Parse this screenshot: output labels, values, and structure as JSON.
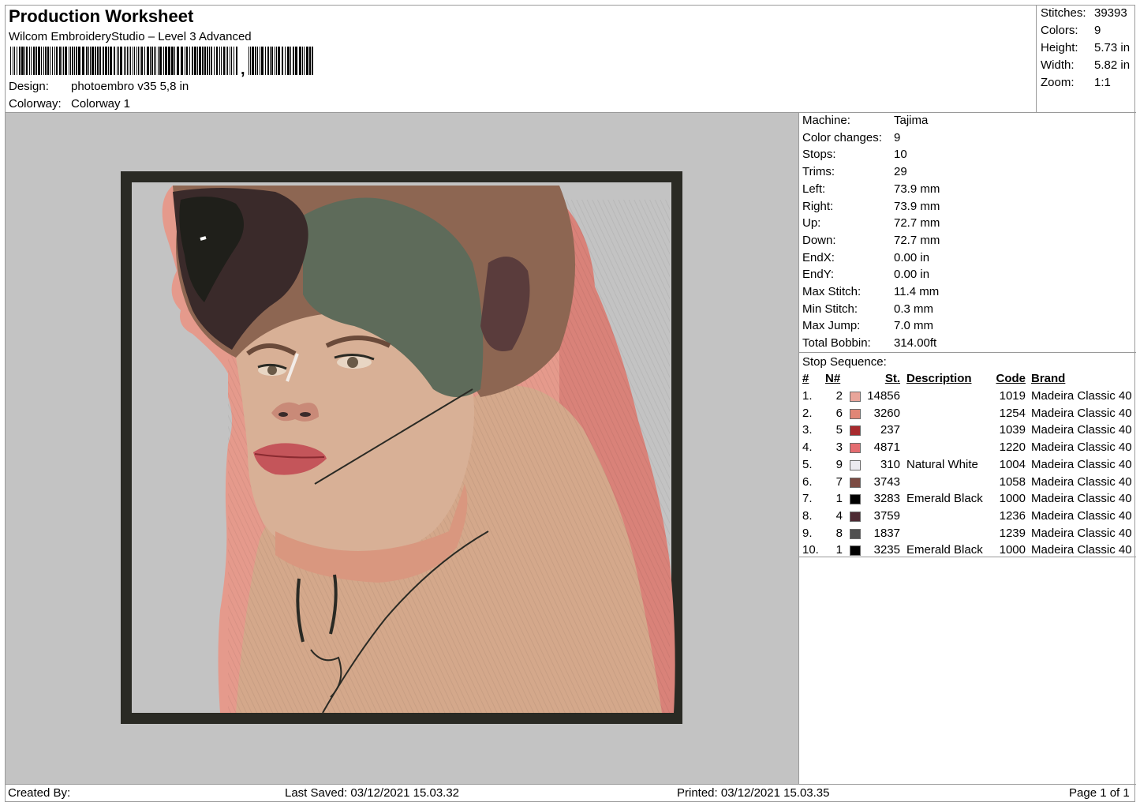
{
  "header": {
    "title": "Production Worksheet",
    "subtitle": "Wilcom EmbroideryStudio – Level 3 Advanced",
    "design_label": "Design:",
    "design_value": "photoembro v35 5,8 in",
    "colorway_label": "Colorway:",
    "colorway_value": "Colorway 1"
  },
  "summary": [
    {
      "label": "Stitches:",
      "value": "39393"
    },
    {
      "label": "Colors:",
      "value": "9"
    },
    {
      "label": "Height:",
      "value": "5.73 in"
    },
    {
      "label": "Width:",
      "value": "5.82 in"
    },
    {
      "label": "Zoom:",
      "value": "1:1"
    }
  ],
  "machine_info": [
    {
      "label": "Machine:",
      "value": "Tajima"
    },
    {
      "label": "Color changes:",
      "value": "9"
    },
    {
      "label": "Stops:",
      "value": "10"
    },
    {
      "label": "Trims:",
      "value": "29"
    },
    {
      "label": "Left:",
      "value": "73.9 mm"
    },
    {
      "label": "Right:",
      "value": "73.9 mm"
    },
    {
      "label": "Up:",
      "value": "72.7 mm"
    },
    {
      "label": "Down:",
      "value": "72.7 mm"
    },
    {
      "label": "EndX:",
      "value": "0.00 in"
    },
    {
      "label": "EndY:",
      "value": "0.00 in"
    },
    {
      "label": "Max Stitch:",
      "value": "11.4 mm"
    },
    {
      "label": "Min Stitch:",
      "value": "0.3 mm"
    },
    {
      "label": "Max Jump:",
      "value": "7.0 mm"
    },
    {
      "label": "Total Bobbin:",
      "value": "314.00ft"
    }
  ],
  "stop_sequence": {
    "title": "Stop Sequence:",
    "headers": {
      "num": "#",
      "n": "N#",
      "st": "St.",
      "desc": "Description",
      "code": "Code",
      "brand": "Brand"
    },
    "rows": [
      {
        "num": "1.",
        "n": "2",
        "color": "#e9a59a",
        "st": "14856",
        "desc": "",
        "code": "1019",
        "brand": "Madeira Classic 40"
      },
      {
        "num": "2.",
        "n": "6",
        "color": "#e08676",
        "st": "3260",
        "desc": "",
        "code": "1254",
        "brand": "Madeira Classic 40"
      },
      {
        "num": "3.",
        "n": "5",
        "color": "#a82a2e",
        "st": "237",
        "desc": "",
        "code": "1039",
        "brand": "Madeira Classic 40"
      },
      {
        "num": "4.",
        "n": "3",
        "color": "#e46c70",
        "st": "4871",
        "desc": "",
        "code": "1220",
        "brand": "Madeira Classic 40"
      },
      {
        "num": "5.",
        "n": "9",
        "color": "#eceaf0",
        "st": "310",
        "desc": "Natural White",
        "code": "1004",
        "brand": "Madeira Classic 40"
      },
      {
        "num": "6.",
        "n": "7",
        "color": "#7b4a42",
        "st": "3743",
        "desc": "",
        "code": "1058",
        "brand": "Madeira Classic 40"
      },
      {
        "num": "7.",
        "n": "1",
        "color": "#000000",
        "st": "3283",
        "desc": "Emerald Black",
        "code": "1000",
        "brand": "Madeira Classic 40"
      },
      {
        "num": "8.",
        "n": "4",
        "color": "#4e2a33",
        "st": "3759",
        "desc": "",
        "code": "1236",
        "brand": "Madeira Classic 40"
      },
      {
        "num": "9.",
        "n": "8",
        "color": "#505050",
        "st": "1837",
        "desc": "",
        "code": "1239",
        "brand": "Madeira Classic 40"
      },
      {
        "num": "10.",
        "n": "1",
        "color": "#000000",
        "st": "3235",
        "desc": "Emerald Black",
        "code": "1000",
        "brand": "Madeira Classic 40"
      }
    ]
  },
  "footer": {
    "created_by": "Created By:",
    "last_saved": "Last Saved: 03/12/2021 15.03.32",
    "printed": "Printed: 03/12/2021 15.03.35",
    "page": "Page 1 of 1"
  }
}
